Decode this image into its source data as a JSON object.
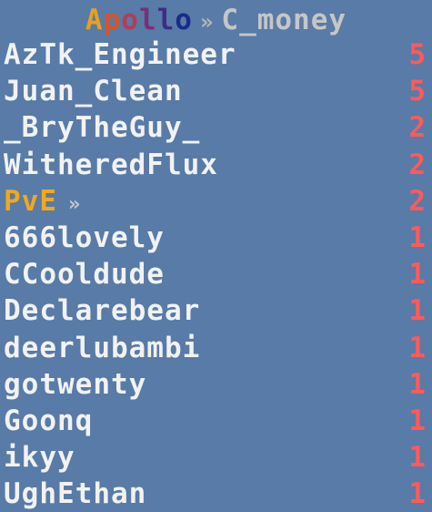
{
  "header": {
    "title_letters": [
      "A",
      "p",
      "o",
      "l",
      "l",
      "o"
    ],
    "separator": "»",
    "name": "C_money"
  },
  "rows": [
    {
      "player": "AzTk_Engineer",
      "score": "5"
    },
    {
      "player": "Juan_Clean",
      "score": "5"
    },
    {
      "player": "_BryTheGuy_",
      "score": "2"
    },
    {
      "player": "WitheredFlux",
      "score": "2"
    },
    {
      "player": "PvE",
      "arrow": "»",
      "score": "2",
      "team": true
    },
    {
      "player": "666lovely",
      "score": "1"
    },
    {
      "player": "CCooldude",
      "score": "1"
    },
    {
      "player": "Declarebear",
      "score": "1"
    },
    {
      "player": "deerlubambi",
      "score": "1"
    },
    {
      "player": "gotwenty",
      "score": "1"
    },
    {
      "player": "Goonq",
      "score": "1"
    },
    {
      "player": "ikyy",
      "score": "1"
    },
    {
      "player": "UghEthan",
      "score": "1"
    }
  ],
  "colors": {
    "background": "#587ba7",
    "player_text": "#f2f2f2",
    "team_text": "#f2a81c",
    "score_text": "#ff5a5a",
    "name_text": "#c6c6c6"
  }
}
